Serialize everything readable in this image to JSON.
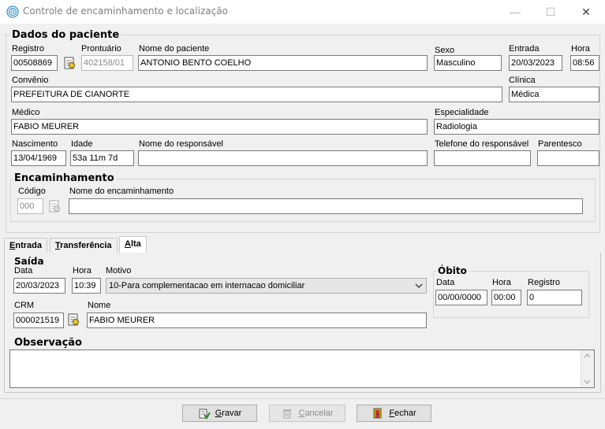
{
  "window": {
    "title": "Controle de encaminhamento e localização",
    "minimize": "—",
    "maximize": "☐",
    "close": "✕"
  },
  "patient": {
    "title": "Dados do paciente",
    "registro_label": "Registro",
    "registro": "00508869",
    "prontuario_label": "Prontuário",
    "prontuario": "402158/01",
    "nome_label": "Nome do paciente",
    "nome": "ANTONIO BENTO COELHO",
    "sexo_label": "Sexo",
    "sexo": "Masculino",
    "entrada_label": "Entrada",
    "entrada": "20/03/2023",
    "hora_label": "Hora",
    "hora": "08:56",
    "convenio_label": "Convênio",
    "convenio": "PREFEITURA DE CIANORTE",
    "clinica_label": "Clínica",
    "clinica": "Médica",
    "medico_label": "Médico",
    "medico": "FABIO MEURER",
    "especialidade_label": "Especialidade",
    "especialidade": "Radiologia",
    "nascimento_label": "Nascimento",
    "nascimento": "13/04/1969",
    "idade_label": "Idade",
    "idade": "53a 11m 7d",
    "responsavel_label": "Nome do responsável",
    "responsavel": "",
    "telefone_label": "Telefone do responsável",
    "telefone": "",
    "parentesco_label": "Parentesco",
    "parentesco": ""
  },
  "encaminhamento": {
    "title": "Encaminhamento",
    "codigo_label": "Código",
    "codigo": "000",
    "nome_label": "Nome do encaminhamento",
    "nome": ""
  },
  "tabs": [
    {
      "label_u": "E",
      "label_rest": "ntrada"
    },
    {
      "label_u": "T",
      "label_rest": "ransferência"
    },
    {
      "label_u": "A",
      "label_rest": "lta"
    }
  ],
  "saida": {
    "title": "Saída",
    "data_label": "Data",
    "data": "20/03/2023",
    "hora_label": "Hora",
    "hora": "10:39",
    "motivo_label": "Motivo",
    "motivo": "10-Para complementacao em internacao domiciliar",
    "crm_label": "CRM",
    "crm": "000021519",
    "nome_label": "Nome",
    "nome": "FABIO MEURER"
  },
  "obito": {
    "title": "Óbito",
    "data_label": "Data",
    "data": "00/00/0000",
    "hora_label": "Hora",
    "hora": "00:00",
    "registro_label": "Registro",
    "registro": "0"
  },
  "observacao": {
    "title": "Observação",
    "value": ""
  },
  "buttons": {
    "gravar_u": "G",
    "gravar_rest": "ravar",
    "cancelar_u": "C",
    "cancelar_rest": "ancelar",
    "fechar_u": "F",
    "fechar_rest": "echar"
  }
}
